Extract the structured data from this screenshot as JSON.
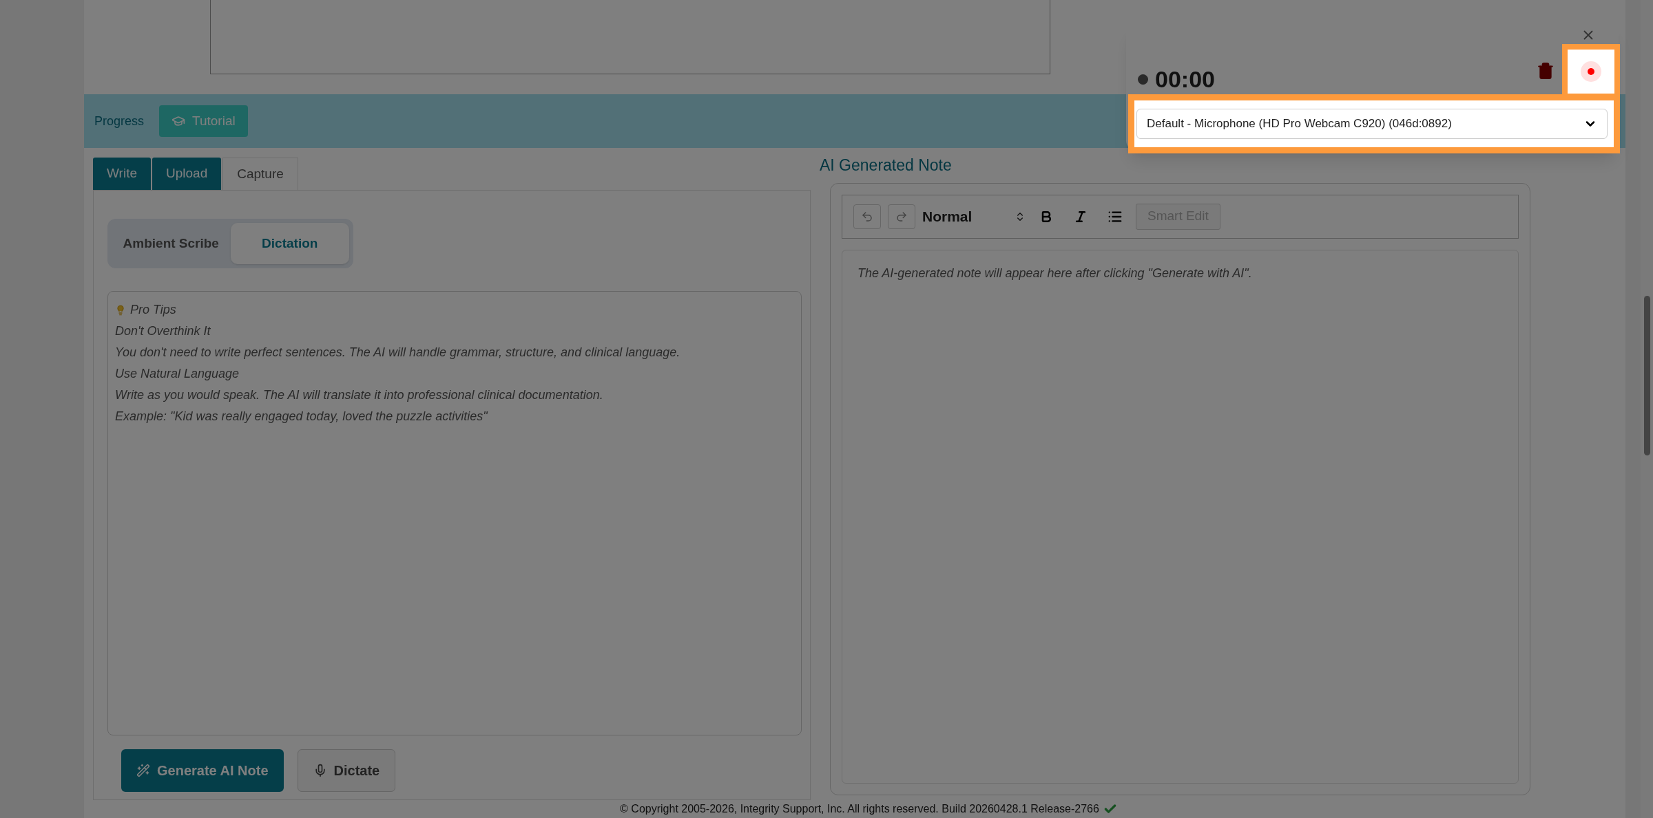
{
  "progress_bar": {
    "label": "Progress",
    "tutorial_button": "Tutorial"
  },
  "input_tabs": [
    {
      "label": "Write",
      "selected": false
    },
    {
      "label": "Upload",
      "selected": false
    },
    {
      "label": "Capture",
      "selected": true
    }
  ],
  "mode_toggle": [
    {
      "label": "Ambient Scribe",
      "selected": false
    },
    {
      "label": "Dictation",
      "selected": true
    }
  ],
  "pro_tips": {
    "title": "Pro Tips",
    "lines": [
      "Don't Overthink It",
      "You don't need to write perfect sentences. The AI will handle grammar, structure, and clinical language.",
      "Use Natural Language",
      "Write as you would speak. The AI will translate it into professional clinical documentation.",
      "Example: \"Kid was really engaged today, loved the puzzle activities\""
    ]
  },
  "actions": [
    {
      "label": "Generate AI Note",
      "kind": "primary"
    },
    {
      "label": "Dictate",
      "kind": "secondary"
    }
  ],
  "ai_note": {
    "heading": "AI Generated Note",
    "format": "Normal",
    "smart_edit": {
      "label": "Smart Edit",
      "disabled": true
    },
    "placeholder": "The AI-generated note will appear here after clicking \"Generate with AI\"."
  },
  "recorder": {
    "timer": "00:00",
    "record_highlighted": true,
    "microphone": "Default - Microphone (HD Pro Webcam C920) (046d:0892)",
    "microphone_highlighted": true
  },
  "footer": {
    "text": "© Copyright 2005-2026, Integrity Support, Inc. All rights reserved. Build 20260428.1 Release-2766"
  }
}
